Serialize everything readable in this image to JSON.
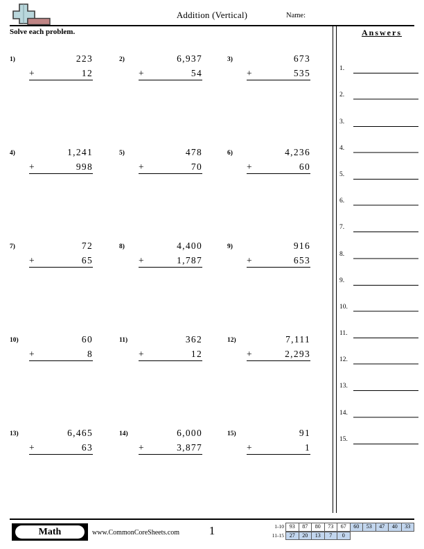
{
  "header": {
    "title": "Addition (Vertical)",
    "name_label": "Name:",
    "logo": {
      "icon": "plus-block-logo",
      "plus_color": "#b9d7dc",
      "bar_color": "#c08585",
      "outline_color": "#333333"
    }
  },
  "instruction": "Solve each problem.",
  "problems": [
    {
      "number": "1)",
      "addend1": "223",
      "operator": "+",
      "addend2": "12"
    },
    {
      "number": "2)",
      "addend1": "6,937",
      "operator": "+",
      "addend2": "54"
    },
    {
      "number": "3)",
      "addend1": "673",
      "operator": "+",
      "addend2": "535"
    },
    {
      "number": "4)",
      "addend1": "1,241",
      "operator": "+",
      "addend2": "998"
    },
    {
      "number": "5)",
      "addend1": "478",
      "operator": "+",
      "addend2": "70"
    },
    {
      "number": "6)",
      "addend1": "4,236",
      "operator": "+",
      "addend2": "60"
    },
    {
      "number": "7)",
      "addend1": "72",
      "operator": "+",
      "addend2": "65"
    },
    {
      "number": "8)",
      "addend1": "4,400",
      "operator": "+",
      "addend2": "1,787"
    },
    {
      "number": "9)",
      "addend1": "916",
      "operator": "+",
      "addend2": "653"
    },
    {
      "number": "10)",
      "addend1": "60",
      "operator": "+",
      "addend2": "8"
    },
    {
      "number": "11)",
      "addend1": "362",
      "operator": "+",
      "addend2": "12"
    },
    {
      "number": "12)",
      "addend1": "7,111",
      "operator": "+",
      "addend2": "2,293"
    },
    {
      "number": "13)",
      "addend1": "6,465",
      "operator": "+",
      "addend2": "63"
    },
    {
      "number": "14)",
      "addend1": "6,000",
      "operator": "+",
      "addend2": "3,877"
    },
    {
      "number": "15)",
      "addend1": "91",
      "operator": "+",
      "addend2": "1"
    }
  ],
  "answers": {
    "heading": "Answers",
    "items": [
      {
        "label": "1.",
        "value": ""
      },
      {
        "label": "2.",
        "value": ""
      },
      {
        "label": "3.",
        "value": ""
      },
      {
        "label": "4.",
        "value": ""
      },
      {
        "label": "5.",
        "value": ""
      },
      {
        "label": "6.",
        "value": ""
      },
      {
        "label": "7.",
        "value": ""
      },
      {
        "label": "8.",
        "value": ""
      },
      {
        "label": "9.",
        "value": ""
      },
      {
        "label": "10.",
        "value": ""
      },
      {
        "label": "11.",
        "value": ""
      },
      {
        "label": "12.",
        "value": ""
      },
      {
        "label": "13.",
        "value": ""
      },
      {
        "label": "14.",
        "value": ""
      },
      {
        "label": "15.",
        "value": ""
      }
    ]
  },
  "footer": {
    "badge_label": "Math",
    "site_url": "www.CommonCoreSheets.com",
    "page_number": "1",
    "score_table": {
      "highlight_color": "#c2d6ee",
      "rows": [
        {
          "range": "1-10",
          "cells": [
            {
              "value": "93",
              "highlight": false
            },
            {
              "value": "87",
              "highlight": false
            },
            {
              "value": "80",
              "highlight": false
            },
            {
              "value": "73",
              "highlight": false
            },
            {
              "value": "67",
              "highlight": false
            },
            {
              "value": "60",
              "highlight": true
            },
            {
              "value": "53",
              "highlight": true
            },
            {
              "value": "47",
              "highlight": true
            },
            {
              "value": "40",
              "highlight": true
            },
            {
              "value": "33",
              "highlight": true
            }
          ]
        },
        {
          "range": "11-15",
          "cells": [
            {
              "value": "27",
              "highlight": true
            },
            {
              "value": "20",
              "highlight": true
            },
            {
              "value": "13",
              "highlight": true
            },
            {
              "value": "7",
              "highlight": true
            },
            {
              "value": "0",
              "highlight": true
            }
          ]
        }
      ]
    }
  }
}
